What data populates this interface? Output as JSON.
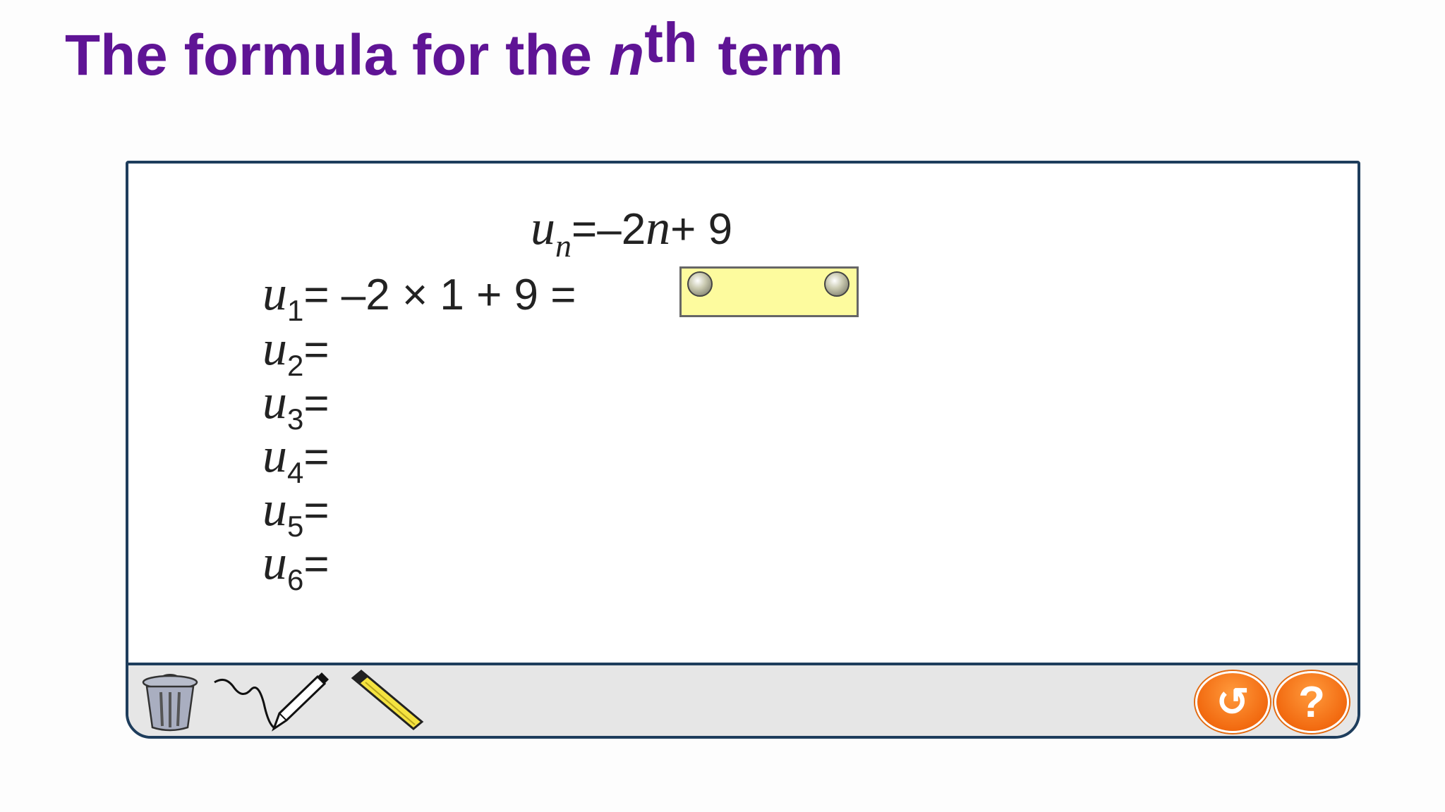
{
  "title": {
    "prefix": "The formula for the",
    "variable": "n",
    "superscript": "th",
    "suffix": "term"
  },
  "formula": {
    "var": "u",
    "sub": "n",
    "rhs_a": "=–2",
    "rhs_var": "n",
    "rhs_b": "+ 9"
  },
  "rows": [
    {
      "var": "u",
      "sub": "1",
      "expr": "= –2 × 1 + 9 ="
    },
    {
      "var": "u",
      "sub": "2",
      "expr": "="
    },
    {
      "var": "u",
      "sub": "3",
      "expr": "="
    },
    {
      "var": "u",
      "sub": "4",
      "expr": "="
    },
    {
      "var": "u",
      "sub": "5",
      "expr": "="
    },
    {
      "var": "u",
      "sub": "6",
      "expr": "="
    }
  ],
  "toolbar": {
    "tools": [
      "trash-icon",
      "pen-icon",
      "highlighter-icon"
    ],
    "reset_icon": "↺",
    "help_label": "?"
  },
  "colors": {
    "title": "#5f1495",
    "panel_border": "#1e3d5c",
    "answer_box": "#fdfb9e",
    "button": "#f26a10"
  }
}
